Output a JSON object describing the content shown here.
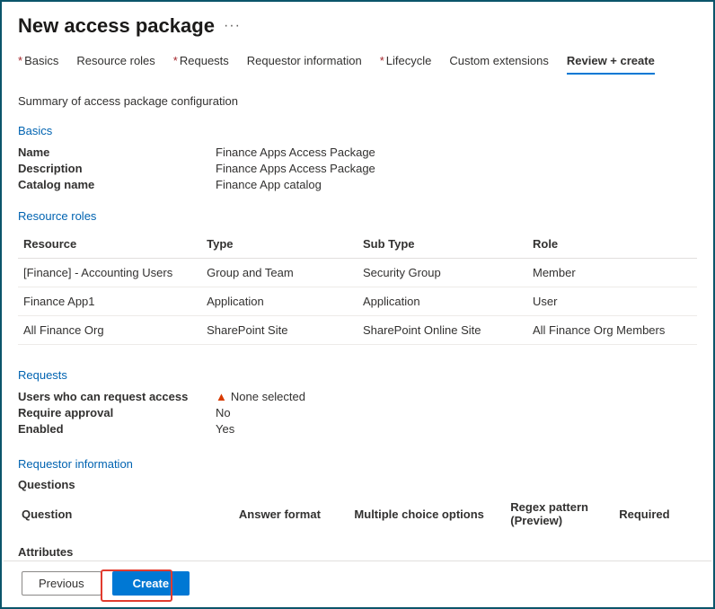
{
  "title": "New access package",
  "ellipsis": "···",
  "tabs": [
    {
      "label": "Basics",
      "required": true
    },
    {
      "label": "Resource roles",
      "required": false
    },
    {
      "label": "Requests",
      "required": true
    },
    {
      "label": "Requestor information",
      "required": false
    },
    {
      "label": "Lifecycle",
      "required": true
    },
    {
      "label": "Custom extensions",
      "required": false
    },
    {
      "label": "Review + create",
      "required": false,
      "active": true
    }
  ],
  "summaryText": "Summary of access package configuration",
  "sections": {
    "basics": {
      "heading": "Basics",
      "nameLabel": "Name",
      "nameValue": "Finance Apps Access Package",
      "descLabel": "Description",
      "descValue": "Finance Apps Access Package",
      "catalogLabel": "Catalog name",
      "catalogValue": "Finance App catalog"
    },
    "resources": {
      "heading": "Resource roles",
      "cols": {
        "resource": "Resource",
        "type": "Type",
        "subtype": "Sub Type",
        "role": "Role"
      },
      "rows": [
        {
          "resource": "[Finance] - Accounting Users",
          "type": "Group and Team",
          "subtype": "Security Group",
          "role": "Member"
        },
        {
          "resource": "Finance App1",
          "type": "Application",
          "subtype": "Application",
          "role": "User"
        },
        {
          "resource": "All Finance Org",
          "type": "SharePoint Site",
          "subtype": "SharePoint Online Site",
          "role": "All Finance Org Members"
        }
      ]
    },
    "requests": {
      "heading": "Requests",
      "whoLabel": "Users who can request access",
      "whoValue": "None selected",
      "approvalLabel": "Require approval",
      "approvalValue": "No",
      "enabledLabel": "Enabled",
      "enabledValue": "Yes"
    },
    "requestorInfo": {
      "heading": "Requestor information",
      "questionsLabel": "Questions",
      "cols": {
        "question": "Question",
        "answerFormat": "Answer format",
        "multi": "Multiple choice options",
        "regex": "Regex pattern (Preview)",
        "required": "Required"
      },
      "attributesLabel": "Attributes"
    }
  },
  "footer": {
    "previous": "Previous",
    "create": "Create"
  }
}
